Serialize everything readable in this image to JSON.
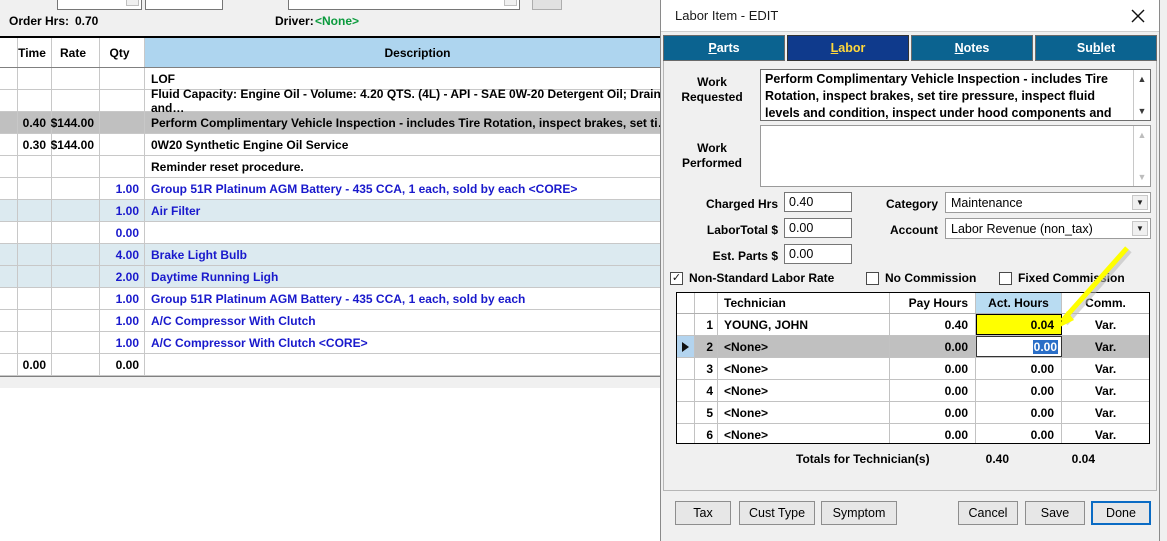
{
  "background": {
    "order_hrs_label": "Order Hrs:",
    "order_hrs_value": "0.70",
    "driver_label": "Driver:",
    "driver_value": "<None>",
    "driver_color": "#0a9a3c"
  },
  "grid": {
    "columns": [
      "",
      "Time",
      "Rate",
      "Qty",
      "Description"
    ],
    "rows": [
      {
        "time": "",
        "rate": "",
        "qty": "",
        "desc": "LOF",
        "style": "white",
        "desc_color": "black"
      },
      {
        "time": "",
        "rate": "",
        "qty": "",
        "desc": "Fluid Capacity:  Engine Oil - Volume: 4.20 QTS. (4L) - API - SAE 0W-20 Detergent Oil; Drain and…",
        "style": "white",
        "desc_color": "black"
      },
      {
        "time": "0.40",
        "rate": "$144.00",
        "qty": "",
        "desc": "Perform Complimentary Vehicle Inspection - includes Tire Rotation, inspect brakes, set ti…",
        "style": "sel",
        "desc_color": "black"
      },
      {
        "time": "0.30",
        "rate": "$144.00",
        "qty": "",
        "desc": "0W20 Synthetic Engine Oil Service",
        "style": "white",
        "desc_color": "black"
      },
      {
        "time": "",
        "rate": "",
        "qty": "",
        "desc": "Reminder reset procedure.",
        "style": "white",
        "desc_color": "black"
      },
      {
        "time": "",
        "rate": "",
        "qty": "1.00",
        "desc": "Group 51R Platinum AGM Battery - 435 CCA, 1 each, sold by each <CORE>",
        "style": "white",
        "desc_color": "blue"
      },
      {
        "time": "",
        "rate": "",
        "qty": "1.00",
        "desc": "Air Filter",
        "style": "blue",
        "desc_color": "blue"
      },
      {
        "time": "",
        "rate": "",
        "qty": "0.00",
        "desc": "",
        "style": "white",
        "desc_color": "blue"
      },
      {
        "time": "",
        "rate": "",
        "qty": "4.00",
        "desc": "Brake Light Bulb",
        "style": "blue",
        "desc_color": "blue"
      },
      {
        "time": "",
        "rate": "",
        "qty": "2.00",
        "desc": "Daytime Running Ligh",
        "style": "blue",
        "desc_color": "blue"
      },
      {
        "time": "",
        "rate": "",
        "qty": "1.00",
        "desc": "Group 51R Platinum AGM Battery - 435 CCA, 1 each, sold by each",
        "style": "white",
        "desc_color": "blue"
      },
      {
        "time": "",
        "rate": "",
        "qty": "1.00",
        "desc": "A/C Compressor With Clutch",
        "style": "white",
        "desc_color": "blue"
      },
      {
        "time": "",
        "rate": "",
        "qty": "1.00",
        "desc": "A/C Compressor With Clutch <CORE>",
        "style": "white",
        "desc_color": "blue"
      },
      {
        "time": "0.00",
        "rate": "",
        "qty": "0.00",
        "desc": "",
        "style": "white",
        "desc_color": "black"
      }
    ]
  },
  "dialog": {
    "title": "Labor Item - EDIT",
    "close_icon": "close-icon",
    "tabs": [
      {
        "label": "Parts",
        "accel": "P",
        "active": false
      },
      {
        "label": "Labor",
        "accel": "L",
        "active": true
      },
      {
        "label": "Notes",
        "accel": "N",
        "active": false
      },
      {
        "label": "Sublet",
        "accel": "b",
        "active": false
      }
    ],
    "work_requested": {
      "label_line1": "Work",
      "label_line2": "Requested",
      "value": "Perform Complimentary Vehicle Inspection - includes Tire Rotation, inspect brakes, set tire pressure, inspect fluid levels and condition, inspect under hood components and under"
    },
    "work_performed": {
      "label_line1": "Work",
      "label_line2": "Performed",
      "value": ""
    },
    "fields": {
      "charged_hrs_label": "Charged Hrs",
      "charged_hrs_value": "0.40",
      "labor_total_label": "LaborTotal $",
      "labor_total_value": "0.00",
      "est_parts_label": "Est. Parts $",
      "est_parts_value": "0.00",
      "category_label": "Category",
      "category_value": "Maintenance",
      "account_label": "Account",
      "account_value": "Labor Revenue (non_tax)"
    },
    "checkboxes": [
      {
        "label": "Non-Standard Labor Rate",
        "checked": true,
        "mark": "✓"
      },
      {
        "label": "No Commission",
        "checked": false,
        "mark": ""
      },
      {
        "label": "Fixed Commission",
        "checked": false,
        "mark": ""
      }
    ],
    "tech_grid": {
      "columns": [
        "Technician",
        "Pay Hours",
        "Act. Hours",
        "Comm."
      ],
      "rows": [
        {
          "num": "1",
          "tech": "YOUNG, JOHN",
          "pay": "0.40",
          "act": "0.04",
          "comm": "Var.",
          "selected": false,
          "act_highlight": "yellow"
        },
        {
          "num": "2",
          "tech": "<None>",
          "pay": "0.00",
          "act": "0.00",
          "comm": "Var.",
          "selected": true,
          "act_highlight": "editing"
        },
        {
          "num": "3",
          "tech": "<None>",
          "pay": "0.00",
          "act": "0.00",
          "comm": "Var.",
          "selected": false,
          "act_highlight": "none"
        },
        {
          "num": "4",
          "tech": "<None>",
          "pay": "0.00",
          "act": "0.00",
          "comm": "Var.",
          "selected": false,
          "act_highlight": "none"
        },
        {
          "num": "5",
          "tech": "<None>",
          "pay": "0.00",
          "act": "0.00",
          "comm": "Var.",
          "selected": false,
          "act_highlight": "none"
        },
        {
          "num": "6",
          "tech": "<None>",
          "pay": "0.00",
          "act": "0.00",
          "comm": "Var.",
          "selected": false,
          "act_highlight": "none"
        }
      ],
      "totals_label": "Totals for Technician(s)",
      "totals_pay": "0.40",
      "totals_act": "0.04"
    },
    "buttons": [
      {
        "label": "Tax",
        "focused": false
      },
      {
        "label": "Cust Type",
        "focused": false
      },
      {
        "label": "Symptom",
        "focused": false
      },
      {
        "label": "Cancel",
        "focused": false
      },
      {
        "label": "Save",
        "focused": false
      },
      {
        "label": "Done",
        "focused": true
      }
    ]
  },
  "annotation": {
    "type": "arrow",
    "color": "#ffff00",
    "points_to": "act-hours-column"
  }
}
